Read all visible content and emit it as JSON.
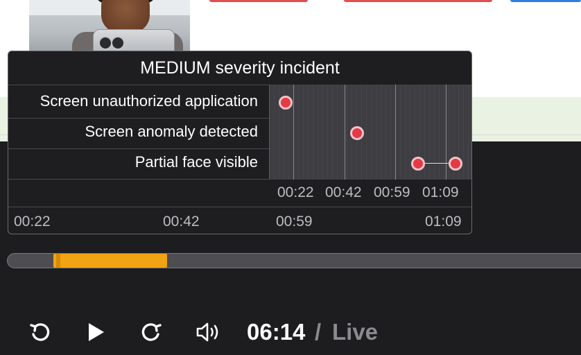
{
  "incident_popup": {
    "title": "MEDIUM severity incident",
    "severity": "MEDIUM",
    "rows": [
      {
        "label": "Screen unauthorized application",
        "events": [
          "00:22"
        ]
      },
      {
        "label": "Screen anomaly detected",
        "events": [
          "00:49"
        ]
      },
      {
        "label": "Partial face visible",
        "events": [
          "01:04",
          "01:09"
        ]
      }
    ],
    "inner_axis_ticks": [
      "00:22",
      "00:42",
      "00:59",
      "01:09"
    ],
    "outer_axis_ticks": [
      "00:22",
      "00:42",
      "00:59",
      "01:09"
    ],
    "marker_color": "#e53946"
  },
  "player": {
    "current_time": "06:14",
    "separator": "/",
    "live_label": "Live",
    "progress_highlight_color": "#f0a414",
    "controls": {
      "rewind_icon": "replay-icon",
      "play_icon": "play-icon",
      "forward_icon": "redo-icon",
      "volume_icon": "volume-icon"
    }
  }
}
